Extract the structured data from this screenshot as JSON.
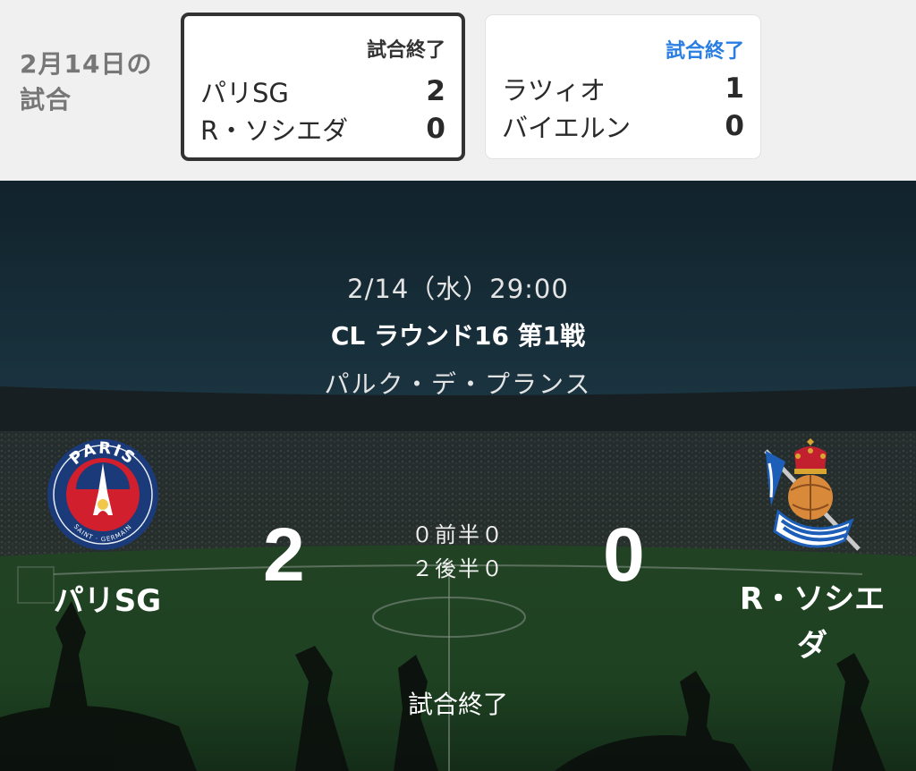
{
  "day_header": {
    "label_line1": "2月14日の",
    "label_line2": "試合"
  },
  "mini_matches": [
    {
      "status": "試合終了",
      "home": "パリSG",
      "home_score": "2",
      "away": "R・ソシエダ",
      "away_score": "0",
      "selected": true
    },
    {
      "status": "試合終了",
      "home": "ラツィオ",
      "home_score": "1",
      "away": "バイエルン",
      "away_score": "0",
      "selected": false,
      "status_color": "#2a7de1"
    }
  ],
  "match": {
    "date": "2/14（水）29:00",
    "competition": "CL ラウンド16 第1戦",
    "venue": "パルク・デ・プランス",
    "home": {
      "name": "パリSG",
      "score": "2",
      "crest_text_top": "PARIS",
      "crest_text_bottom": "SAINT · GERMAIN",
      "crest_icon": "psg-crest-icon"
    },
    "away": {
      "name_line1": "R・ソシエ",
      "name_line2": "ダ",
      "score": "0",
      "crest_icon": "real-sociedad-crest-icon"
    },
    "first_half": "０前半０",
    "second_half": "２後半０",
    "status": "試合終了"
  },
  "colors": {
    "accent_blue": "#2a7de1",
    "psg_navy": "#1b3a7a",
    "psg_red": "#d11f2d",
    "sociedad_blue": "#1d5fb8",
    "sociedad_gold": "#d9a531"
  }
}
